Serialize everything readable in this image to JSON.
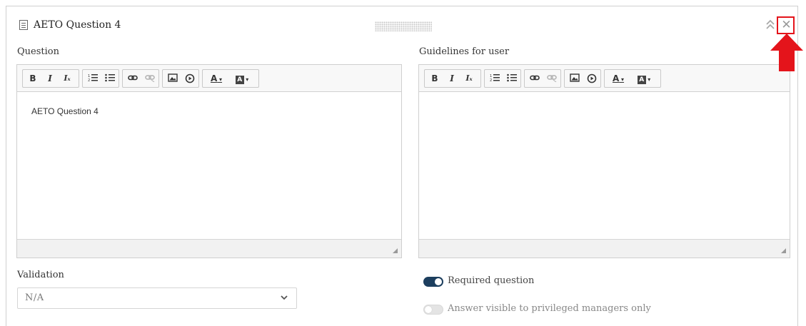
{
  "panel": {
    "title": "AETO Question 4",
    "icons": {
      "doc": "document-icon",
      "drag": "drag-handle",
      "collapse": "double-chevron-up-icon",
      "close": "close-icon",
      "annotation": "red-arrow-up"
    },
    "close_glyph": "✕",
    "collapse_glyph": "︽",
    "highlight_color": "#e4141b"
  },
  "question": {
    "label": "Question",
    "content": "AETO Question 4"
  },
  "guidelines": {
    "label": "Guidelines for user",
    "content": ""
  },
  "toolbar": {
    "bold": "B",
    "italic": "I",
    "remove_format": "Iₓ",
    "font_color": "A",
    "bg_color": "A",
    "buttons": [
      "bold",
      "italic",
      "remove-format",
      "numbered-list",
      "bulleted-list",
      "link",
      "unlink",
      "image",
      "video",
      "text-color",
      "background-color"
    ]
  },
  "validation": {
    "label": "Validation",
    "value": "N/A"
  },
  "required": {
    "label": "Required question",
    "on": true,
    "accent": "#1c3e5e"
  },
  "privileged": {
    "label": "Answer visible to privileged managers only",
    "on": false
  }
}
